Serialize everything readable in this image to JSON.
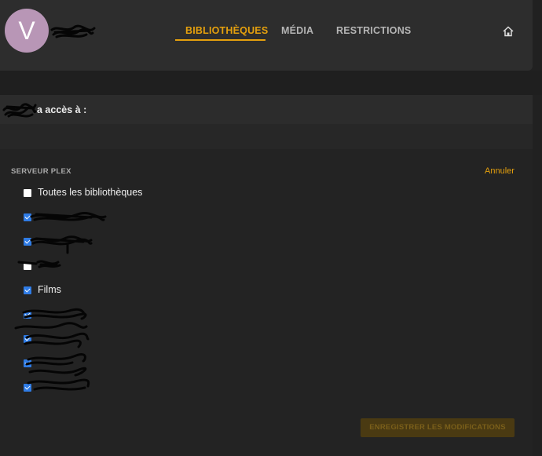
{
  "header": {
    "avatar_letter": "V",
    "tabs": [
      {
        "label": "BIBLIOTHÈQUES",
        "active": true
      },
      {
        "label": "MÉDIA",
        "active": false
      },
      {
        "label": "RESTRICTIONS",
        "active": false
      }
    ],
    "home_icon": "home-icon"
  },
  "access": {
    "label": "a accès à :"
  },
  "server": {
    "title": "SERVEUR PLEX",
    "cancel_label": "Annuler",
    "libraries": [
      {
        "label": "Toutes les bibliothèques",
        "checked": false,
        "redacted": false
      },
      {
        "label": "",
        "checked": true,
        "redacted": true
      },
      {
        "label": "",
        "checked": true,
        "redacted": true
      },
      {
        "label": "",
        "checked": false,
        "redacted": true
      },
      {
        "label": "Films",
        "checked": true,
        "redacted": false
      },
      {
        "label": "",
        "checked": true,
        "redacted": true
      },
      {
        "label": "",
        "checked": true,
        "redacted": true
      },
      {
        "label": "",
        "checked": true,
        "redacted": true
      },
      {
        "label": "",
        "checked": true,
        "redacted": true
      }
    ],
    "save_label": "ENREGISTRER LES MODIFICATIONS"
  },
  "colors": {
    "accent": "#e5a00d",
    "checkbox_checked": "#2f7ce6",
    "avatar_bg": "#b896b6"
  }
}
